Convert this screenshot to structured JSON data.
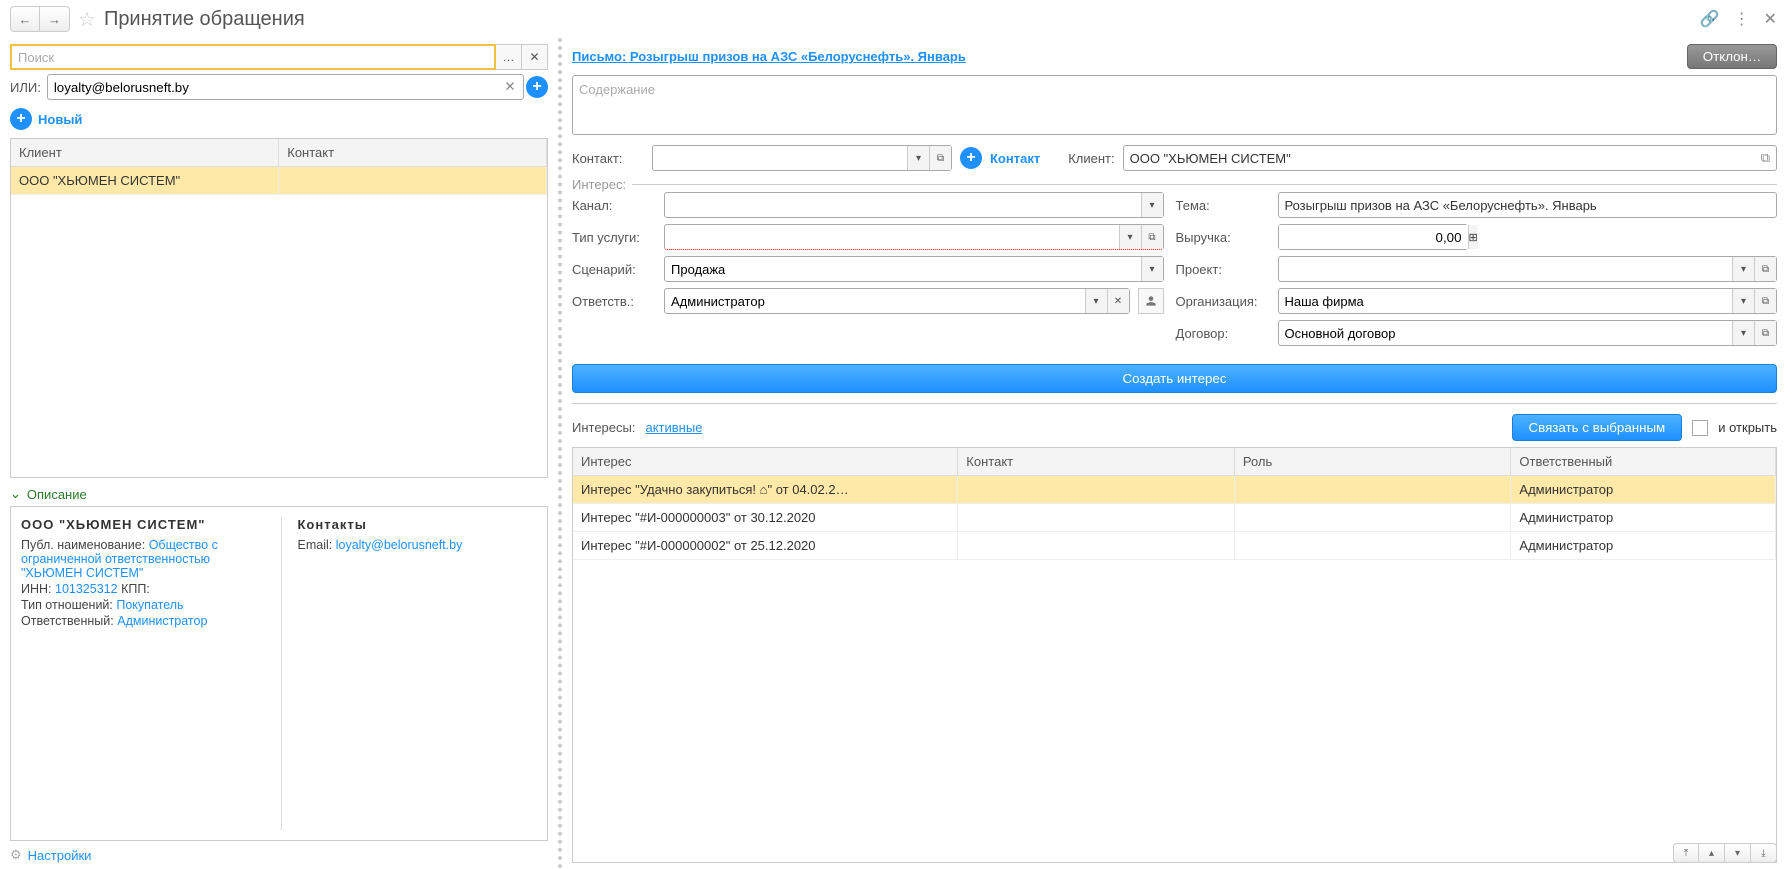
{
  "header": {
    "title": "Принятие обращения"
  },
  "left": {
    "search_placeholder": "Поиск",
    "or_label": "ИЛИ:",
    "or_value": "loyalty@belorusneft.by",
    "new_label": "Новый",
    "table": {
      "col_client": "Клиент",
      "col_contact": "Контакт",
      "rows": [
        {
          "client": "ООО \"ХЬЮМЕН СИСТЕМ\"",
          "contact": ""
        }
      ]
    },
    "desc_header": "Описание",
    "desc": {
      "title": "ООО \"ХЬЮМЕН СИСТЕМ\"",
      "pub_label": "Публ. наименование:",
      "pub_value": "Общество с ограниченной ответственностью \"ХЬЮМЕН СИСТЕМ\"",
      "inn_label": "ИНН:",
      "inn_value": "101325312",
      "kpp_label": "КПП:",
      "rel_label": "Тип отношений:",
      "rel_value": "Покупатель",
      "resp_label": "Ответственный:",
      "resp_value": "Администратор",
      "contacts_title": "Контакты",
      "email_label": "Email:",
      "email_value": "loyalty@belorusneft.by"
    },
    "settings": "Настройки"
  },
  "right": {
    "letter_link": "Письмо: Розыгрыш призов на АЗС «Белоруснефть». Январь",
    "reject": "Отклон…",
    "content_placeholder": "Содержание",
    "labels": {
      "contact": "Контакт:",
      "contact_link": "Контакт",
      "client": "Клиент:",
      "client_value": "ООО \"ХЬЮМЕН СИСТЕМ\"",
      "interest_legend": "Интерес:",
      "channel": "Канал:",
      "topic": "Тема:",
      "topic_value": "Розыгрыш призов на АЗС «Белоруснефть». Январь",
      "service": "Тип услуги:",
      "revenue": "Выручка:",
      "revenue_value": "0,00",
      "scenario": "Сценарий:",
      "scenario_value": "Продажа",
      "project": "Проект:",
      "responsible": "Ответств.:",
      "responsible_value": "Администратор",
      "org": "Организация:",
      "org_value": "Наша фирма",
      "contract": "Договор:",
      "contract_value": "Основной договор"
    },
    "create_interest": "Создать интерес",
    "interests_label": "Интересы:",
    "interests_filter": "активные",
    "link_selected": "Связать с выбранным",
    "and_open": "и открыть",
    "int_table": {
      "col_interest": "Интерес",
      "col_contact": "Контакт",
      "col_role": "Роль",
      "col_resp": "Ответственный",
      "rows": [
        {
          "interest": "Интерес \"Удачно закупиться! ⌂\" от 04.02.2…",
          "contact": "",
          "role": "",
          "resp": "Администратор"
        },
        {
          "interest": "Интерес \"#И-000000003\" от 30.12.2020",
          "contact": "",
          "role": "",
          "resp": "Администратор"
        },
        {
          "interest": "Интерес \"#И-000000002\" от 25.12.2020",
          "contact": "",
          "role": "",
          "resp": "Администратор"
        }
      ]
    }
  }
}
